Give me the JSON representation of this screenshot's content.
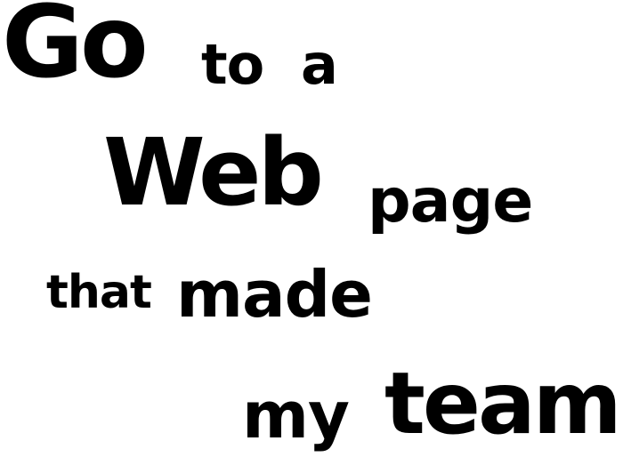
{
  "words": {
    "go": "Go",
    "to": "to",
    "a": "a",
    "web": "Web",
    "page": "page",
    "that": "that",
    "made": "made",
    "my": "my",
    "team": "team"
  },
  "colors": {
    "text": "#000000",
    "background": "#ffffff"
  }
}
